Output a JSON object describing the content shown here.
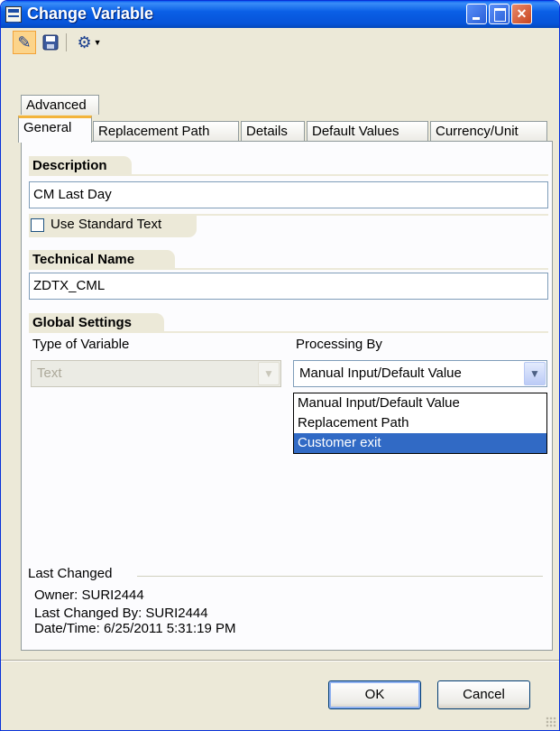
{
  "window": {
    "title": "Change Variable"
  },
  "toolbar": {
    "edit_icon": "pencil-glasses-icon",
    "save_icon": "floppy-disk-icon",
    "tools_icon": "wrench-tools-icon"
  },
  "tabs": [
    {
      "label": "Advanced"
    },
    {
      "label": "General",
      "active": true
    },
    {
      "label": "Replacement Path"
    },
    {
      "label": "Details"
    },
    {
      "label": "Default Values"
    },
    {
      "label": "Currency/Unit"
    }
  ],
  "description": {
    "header": "Description",
    "value": "CM Last Day",
    "use_standard_text_label": "Use Standard Text",
    "use_standard_text_checked": false
  },
  "technical_name": {
    "header": "Technical Name",
    "value": "ZDTX_CML"
  },
  "global_settings": {
    "header": "Global Settings",
    "type_label": "Type of Variable",
    "type_value": "Text",
    "processing_label": "Processing By",
    "processing_value": "Manual Input/Default Value",
    "processing_options": [
      "Manual Input/Default Value",
      "Replacement Path",
      "Customer exit"
    ],
    "highlighted_option": "Customer exit"
  },
  "last_changed": {
    "header": "Last Changed",
    "owner": "Owner: SURI2444",
    "changed_by": "Last Changed By: SURI2444",
    "datetime": "Date/Time: 6/25/2011 5:31:19 PM"
  },
  "buttons": {
    "ok": "OK",
    "cancel": "Cancel"
  },
  "colors": {
    "titlebar": "#0a5fe6",
    "selection": "#316ac5",
    "dialog_bg": "#ece9d8",
    "active_tab_accent": "#f3b43c"
  }
}
